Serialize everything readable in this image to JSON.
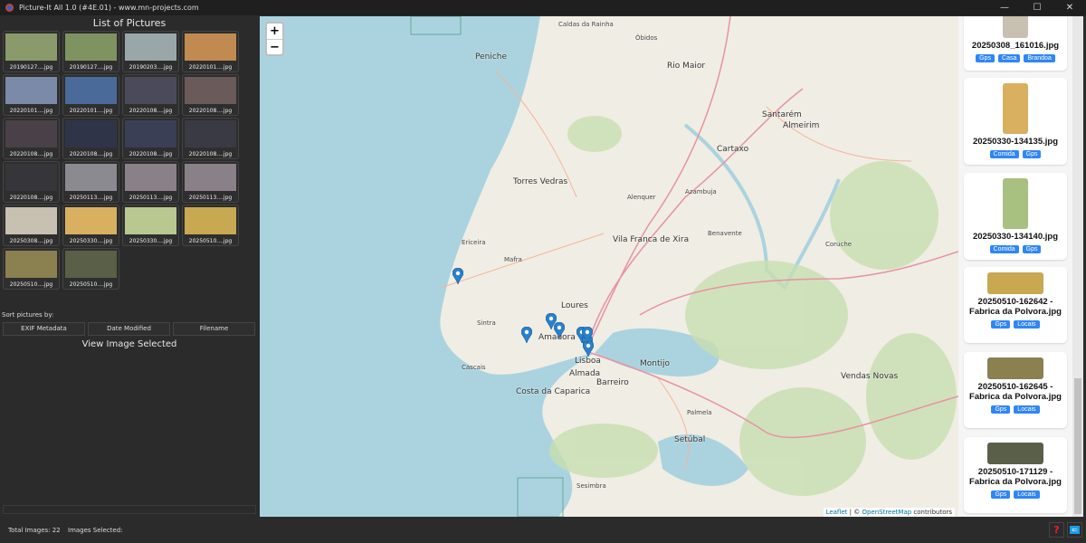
{
  "window": {
    "title": "Picture-It All 1.0 (#4E.01) - www.mn-projects.com",
    "minimize": "—",
    "maximize": "☐",
    "close": "✕"
  },
  "left": {
    "heading": "List of Pictures",
    "thumbnails": [
      {
        "caption": "20190127....jpg",
        "color": "#8a9a6a"
      },
      {
        "caption": "20190127....jpg",
        "color": "#7f9360"
      },
      {
        "caption": "20190203....jpg",
        "color": "#9aa7a8"
      },
      {
        "caption": "20220101....jpg",
        "color": "#c08a50"
      },
      {
        "caption": "20220101....jpg",
        "color": "#7a8aa8"
      },
      {
        "caption": "20220101....jpg",
        "color": "#4a6a9a"
      },
      {
        "caption": "20220108....jpg",
        "color": "#4a4a5a"
      },
      {
        "caption": "20220108....jpg",
        "color": "#6a5a5a"
      },
      {
        "caption": "20220108....jpg",
        "color": "#4a4048"
      },
      {
        "caption": "20220108....jpg",
        "color": "#2f3448"
      },
      {
        "caption": "20220108....jpg",
        "color": "#3a3f55"
      },
      {
        "caption": "20220108....jpg",
        "color": "#3a3a44"
      },
      {
        "caption": "20220108....jpg",
        "color": "#35353a"
      },
      {
        "caption": "20250113....jpg",
        "color": "#8a8a90"
      },
      {
        "caption": "20250113....jpg",
        "color": "#8a8088"
      },
      {
        "caption": "20250113....jpg",
        "color": "#8a8088"
      },
      {
        "caption": "20250308....jpg",
        "color": "#c8c0b0"
      },
      {
        "caption": "20250330....jpg",
        "color": "#d8b060"
      },
      {
        "caption": "20250330....jpg",
        "color": "#b8c890"
      },
      {
        "caption": "20250510....jpg",
        "color": "#c8a850"
      },
      {
        "caption": "20250510....jpg",
        "color": "#8a8050"
      },
      {
        "caption": "20250510....jpg",
        "color": "#5a6048"
      }
    ],
    "sort_label": "Sort pictures by:",
    "sort_buttons": [
      "EXIF Metadata",
      "Date Modified",
      "Filename"
    ],
    "view_selected": "View Image Selected"
  },
  "map": {
    "zoom_in": "+",
    "zoom_out": "−",
    "attribution_leaflet": "Leaflet",
    "attribution_sep": " | © ",
    "attribution_osm": "OpenStreetMap",
    "attribution_rest": " contributors",
    "places": [
      "Caldas da Rainha",
      "Peniche",
      "Rio Maior",
      "Torres Vedras",
      "Santarém",
      "Almeirim",
      "Cartaxo",
      "Alenquer",
      "Vila Franca de Xira",
      "Ericeira",
      "Mafra",
      "Loures",
      "Amadora",
      "Lisboa",
      "Cascais",
      "Almada",
      "Barreiro",
      "Montijo",
      "Costa da Caparica",
      "Setúbal",
      "Sesimbra",
      "Benavente",
      "Vendas Novas",
      "Palmela",
      "Sintra",
      "Azambuja",
      "Coruche",
      "Óbidos"
    ]
  },
  "cards": [
    {
      "name": "20250308_161016.jpg",
      "tags": [
        "Gps",
        "Casa",
        "Brandoa"
      ],
      "color": "#c8c0b0"
    },
    {
      "name": "20250330-134135.jpg",
      "tags": [
        "Comida",
        "Gps"
      ],
      "color": "#d8b060"
    },
    {
      "name": "20250330-134140.jpg",
      "tags": [
        "Comida",
        "Gps"
      ],
      "color": "#a8c080"
    },
    {
      "name": "20250510-162642 - Fabrica da Polvora.jpg",
      "tags": [
        "Gps",
        "Locais"
      ],
      "color": "#c8a850"
    },
    {
      "name": "20250510-162645 - Fabrica da Polvora.jpg",
      "tags": [
        "Gps",
        "Locais"
      ],
      "color": "#8a8050"
    },
    {
      "name": "20250510-171129 - Fabrica da Polvora.jpg",
      "tags": [
        "Gps",
        "Locais"
      ],
      "color": "#5a6048"
    }
  ],
  "status": {
    "total": "Total Images: 22",
    "selected": "Images Selected:",
    "help": "?",
    "back": "⇐"
  }
}
